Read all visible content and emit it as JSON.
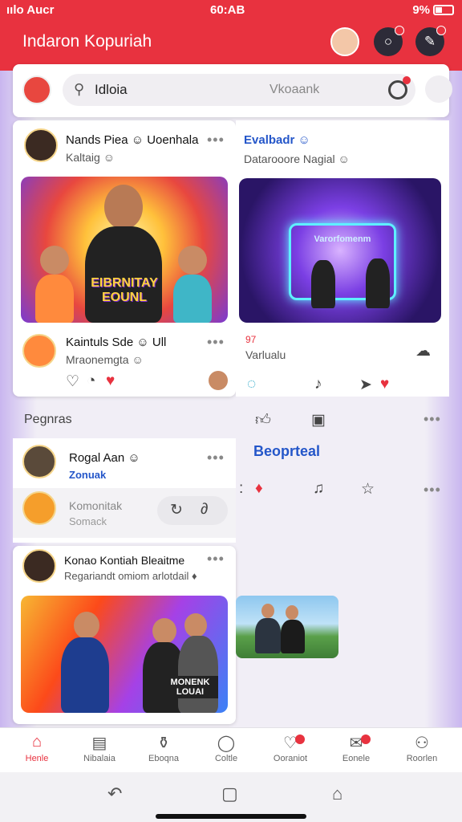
{
  "status": {
    "carrier": "ıılo Aucr",
    "time": "60:AB",
    "battery": "9%"
  },
  "app": {
    "title": "Indaron Kopuriah"
  },
  "search": {
    "value": "Idloia",
    "placeholder": "Vkoaank"
  },
  "feed_left": [
    {
      "name": "Nands Piea ☺ Uoenhala",
      "sub": "Kaltaig ☺",
      "banner": "ЕIBRNITAY EOUNL"
    },
    {
      "name": "Kaintuls Sde ☺ Ull",
      "sub": "Mraonemgta ☺"
    }
  ],
  "feed_right": {
    "name": "Evalbadr ☺",
    "sub": "Datarooore Nagial ☺",
    "screen_text": "Varorfomenm",
    "count": "97",
    "caption": "Varlualu"
  },
  "section": {
    "title": "Pegnras"
  },
  "people": [
    {
      "name": "Rogal Aan ☺",
      "sub": "Zonuak"
    },
    {
      "name": "Komonitak",
      "sub": "Somack"
    }
  ],
  "feed_right2": {
    "name": "Beoprteal"
  },
  "post3": {
    "name": "Konao Kontiah Bleaitme",
    "sub": "Regariandt omiom arlotdail ♦",
    "banner": "MONENK LOUAI"
  },
  "nav": [
    {
      "label": "Henle"
    },
    {
      "label": "Nibalaia"
    },
    {
      "label": "Eboqna"
    },
    {
      "label": "Coltle"
    },
    {
      "label": "Ooraniot"
    },
    {
      "label": "Eonele"
    },
    {
      "label": "Roorlen"
    }
  ]
}
